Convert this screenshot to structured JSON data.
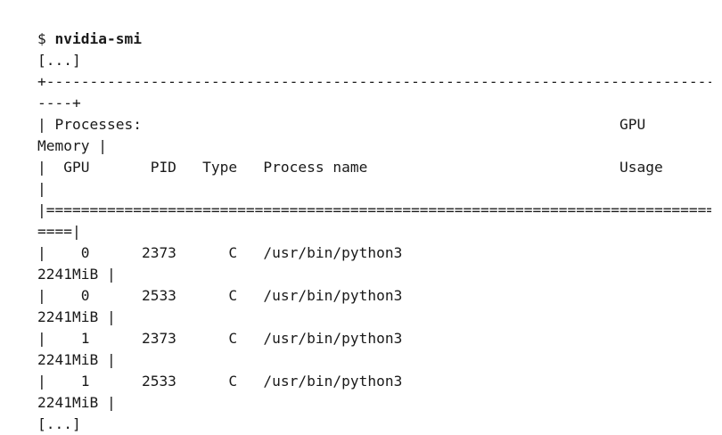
{
  "terminal": {
    "prompt": "$ ",
    "command": "nvidia-smi",
    "lines": [
      "[...]",
      "+-----------------------------------------------------------------------------",
      "----+",
      "| Processes:                                                       GPU",
      "Memory |",
      "|  GPU       PID   Type   Process name                             Usage",
      "|",
      "|=============================================================================",
      "====|",
      "|    0      2373      C   /usr/bin/python3",
      "2241MiB |",
      "|    0      2533      C   /usr/bin/python3",
      "2241MiB |",
      "|    1      2373      C   /usr/bin/python3",
      "2241MiB |",
      "|    1      2533      C   /usr/bin/python3",
      "2241MiB |",
      "[...]"
    ]
  }
}
